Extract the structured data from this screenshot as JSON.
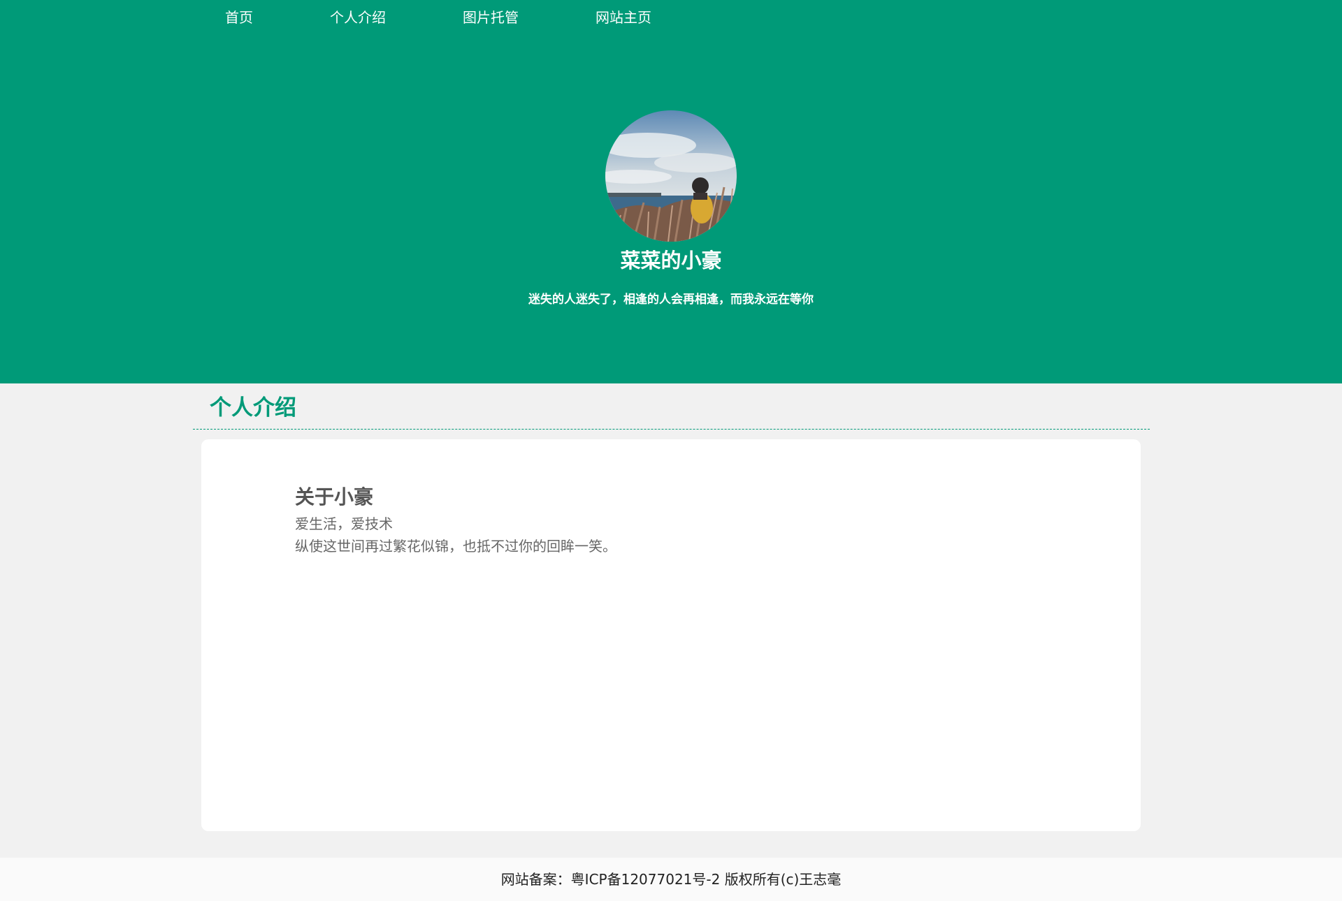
{
  "nav": {
    "items": [
      {
        "label": "首页"
      },
      {
        "label": "个人介绍"
      },
      {
        "label": "图片托管"
      },
      {
        "label": "网站主页"
      }
    ]
  },
  "hero": {
    "title": "菜菜的小豪",
    "motto": "迷失的人迷失了，相逢的人会再相逢，而我永远在等你"
  },
  "section": {
    "heading": "个人介绍"
  },
  "about": {
    "title": "关于小豪",
    "line1": "爱生活，爱技术",
    "line2": "纵使这世间再过繁花似锦，也抵不过你的回眸一笑。"
  },
  "footer": {
    "text": "网站备案：粤ICP备12077021号-2 版权所有(c)王志毫"
  },
  "colors": {
    "brand": "#009a78",
    "background": "#f1f1f1",
    "card": "#ffffff"
  }
}
